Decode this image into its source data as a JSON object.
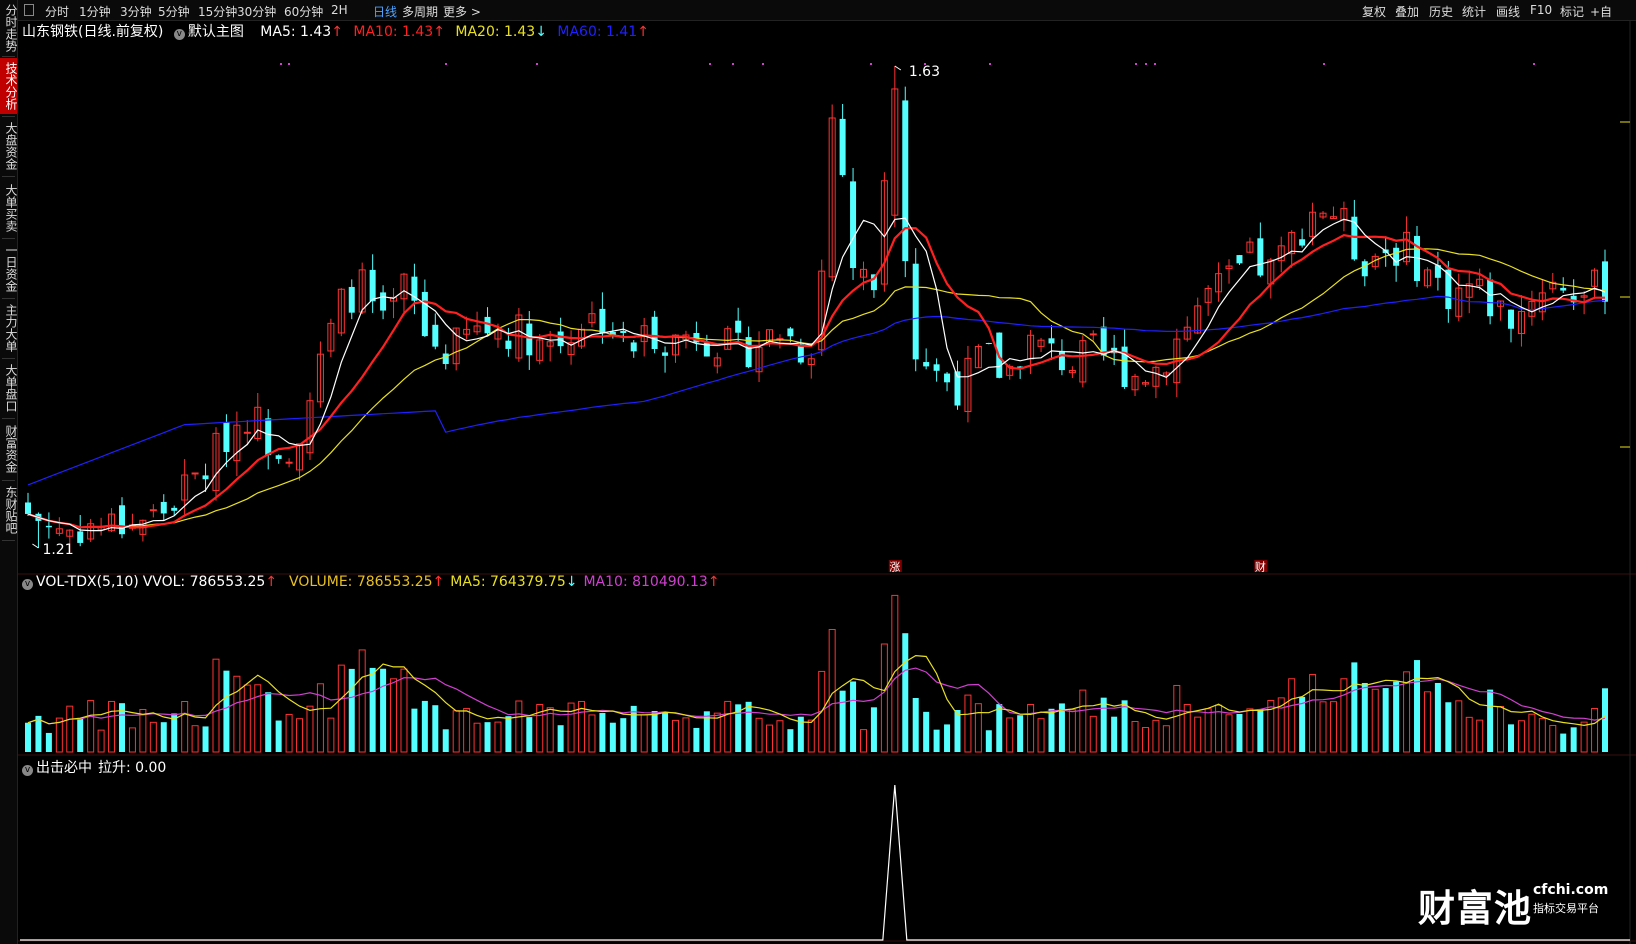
{
  "sidebar": {
    "items": [
      {
        "label": "分时走势",
        "active": false
      },
      {
        "label": "技术分析",
        "active": true
      },
      {
        "label": "大盘资金",
        "active": false
      },
      {
        "label": "大单买卖",
        "active": false
      },
      {
        "label": "一日资金",
        "active": false
      },
      {
        "label": "主力大单",
        "active": false
      },
      {
        "label": "大单盘口",
        "active": false
      },
      {
        "label": "财富资金",
        "active": false
      },
      {
        "label": "东财贴吧",
        "active": false
      }
    ]
  },
  "toolbar": {
    "periods": [
      "分时",
      "1分钟",
      "3分钟",
      "5分钟",
      "15分钟",
      "30分钟",
      "60分钟",
      "2H",
      "日线",
      "多周期",
      "更多 >"
    ],
    "active_period": "日线",
    "right_items": [
      "复权",
      "叠加",
      "历史",
      "统计",
      "画线",
      "F10",
      "标记",
      "+自"
    ]
  },
  "main_chart": {
    "title": "山东钢铁(日线.前复权)",
    "indicator": "默认主图",
    "ma5": {
      "label": "MA5: 1.43",
      "arrow": "↑",
      "color": "#ffffff"
    },
    "ma10": {
      "label": "MA10: 1.43",
      "arrow": "↑",
      "color": "#ff2020"
    },
    "ma20": {
      "label": "MA20: 1.43",
      "arrow": "↓",
      "color": "#e8e020"
    },
    "ma60": {
      "label": "MA60: 1.41",
      "arrow": "↑",
      "color": "#2020ff"
    },
    "high_label": "1.63",
    "low_label": "1.21",
    "markers": [
      "涨",
      "财"
    ]
  },
  "volume_chart": {
    "name": "VOL-TDX(5,10)",
    "vvol": {
      "label": "VVOL: 786553.25",
      "arrow": "↑"
    },
    "volume": {
      "label": "VOLUME: 786553.25",
      "arrow": "↑"
    },
    "ma5": {
      "label": "MA5: 764379.75",
      "arrow": "↓"
    },
    "ma10": {
      "label": "MA10: 810490.13",
      "arrow": "↑"
    }
  },
  "signal_chart": {
    "name": "出击必中",
    "value": "拉升: 0.00"
  },
  "watermark": {
    "brand": "财富池",
    "url": "cfchi.com",
    "sub": "指标交易平台"
  },
  "colors": {
    "up": "#ff3232",
    "down": "#54ffff",
    "ma5": "#ffffff",
    "ma10": "#ff2020",
    "ma20": "#e8e020",
    "ma60": "#2020ff",
    "vol_ma5": "#e8e020",
    "vol_ma10": "#d040d0"
  }
}
